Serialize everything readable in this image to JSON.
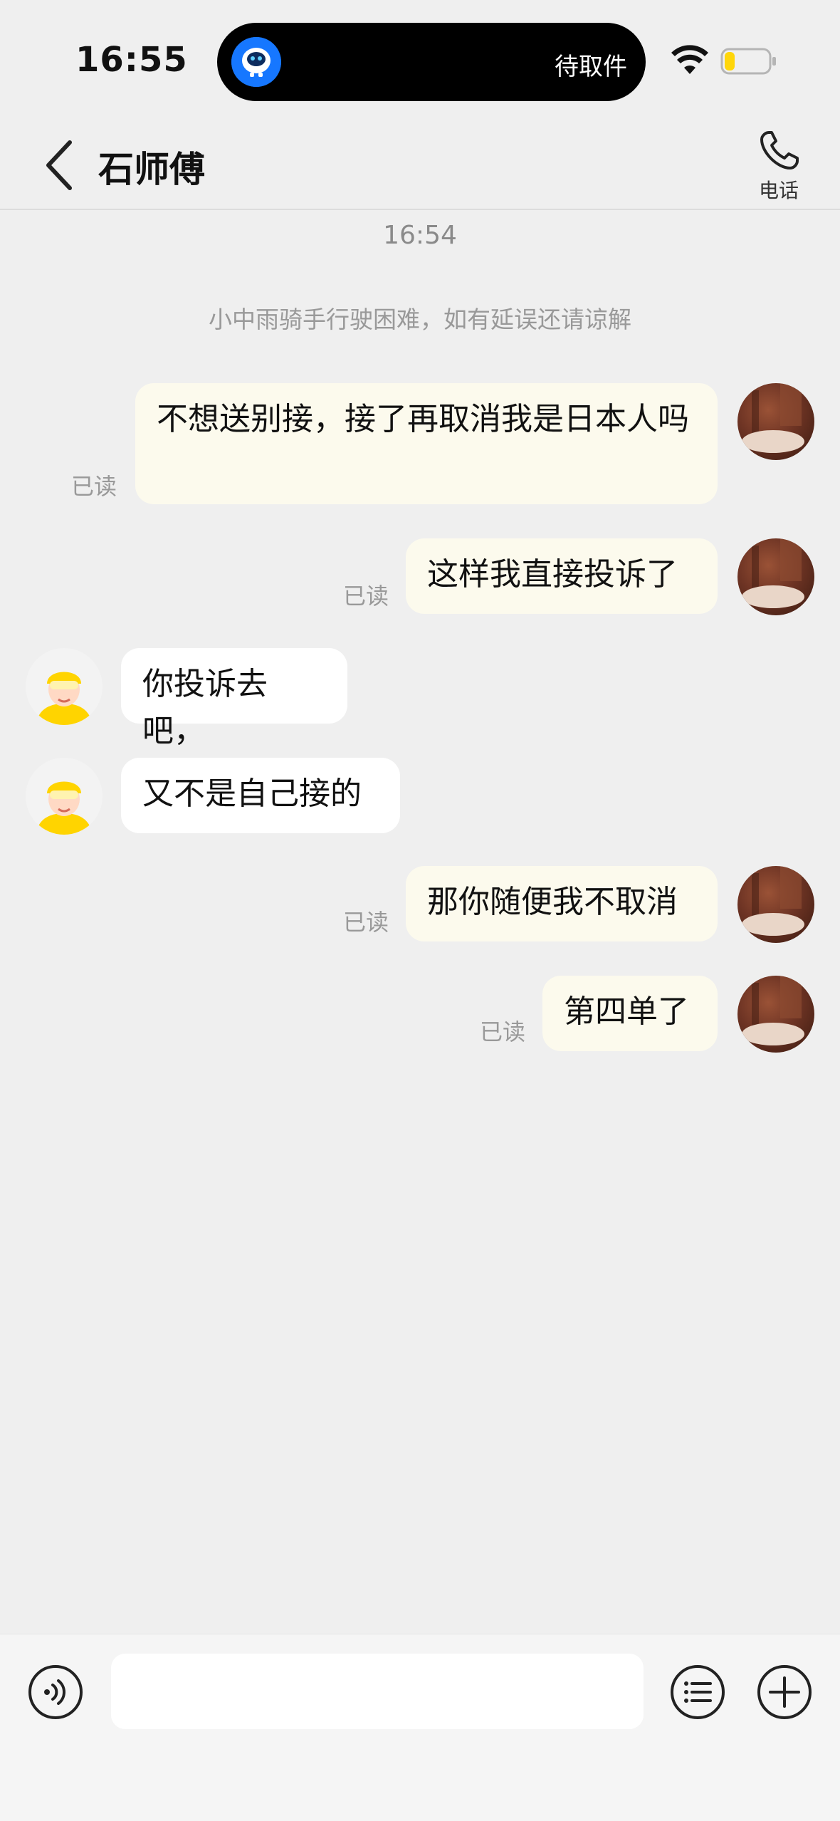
{
  "status_bar": {
    "time": "16:55",
    "island_label": "待取件",
    "icons": [
      "wifi-icon",
      "battery-icon"
    ]
  },
  "header": {
    "title": "石师傅",
    "phone_label": "电话"
  },
  "chat": {
    "timestamp": "16:54",
    "notice": "小中雨骑手行驶困难，如有延误还请谅解",
    "read_label": "已读",
    "messages": [
      {
        "from": "me",
        "text": "不想送别接，接了再取消我是日本人吗",
        "read": true
      },
      {
        "from": "me",
        "text": "这样我直接投诉了",
        "read": true
      },
      {
        "from": "rider",
        "text": "你投诉去吧，"
      },
      {
        "from": "rider",
        "text": "又不是自己接的"
      },
      {
        "from": "me",
        "text": "那你随便我不取消",
        "read": true
      },
      {
        "from": "me",
        "text": "第四单了",
        "read": true
      }
    ]
  },
  "input_bar": {
    "value": "",
    "icons": [
      "voice-icon",
      "quick-reply-icon",
      "plus-icon"
    ]
  },
  "colors": {
    "background": "#efefef",
    "outgoing_bubble": "#fcfaed",
    "incoming_bubble": "#ffffff",
    "rider_yellow": "#ffd400",
    "muted_text": "#999999"
  }
}
